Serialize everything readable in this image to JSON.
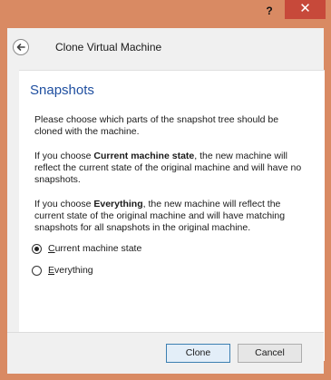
{
  "window": {
    "help_label": "?",
    "close_label": "✕"
  },
  "header": {
    "back_icon": "back-arrow-icon",
    "title": "Clone Virtual Machine"
  },
  "page": {
    "title": "Snapshots",
    "para1": "Please choose which parts of the snapshot tree should be cloned with the machine.",
    "para2_pre": "If you choose ",
    "para2_bold": "Current machine state",
    "para2_post": ", the new machine will reflect the current state of the original machine and will have no snapshots.",
    "para3_pre": "If you choose ",
    "para3_bold": "Everything",
    "para3_post": ", the new machine will reflect the current state of the original machine and will have matching snapshots for all snapshots in the original machine.",
    "options": [
      {
        "prefix": "",
        "mnemonic": "C",
        "suffix": "urrent machine state",
        "checked": true
      },
      {
        "prefix": "",
        "mnemonic": "E",
        "suffix": "verything",
        "checked": false
      }
    ]
  },
  "footer": {
    "clone_label": "Clone",
    "cancel_label": "Cancel"
  }
}
